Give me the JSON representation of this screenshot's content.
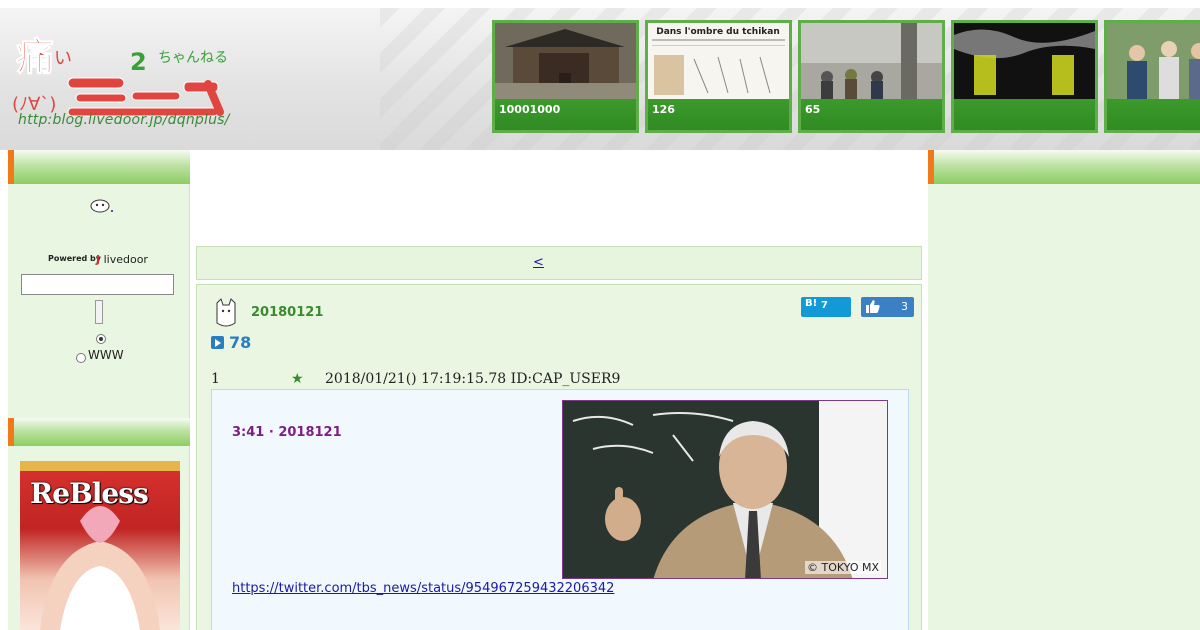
{
  "header": {
    "logo_url_text": "http:blog.livedoor.jp/dqnplus/",
    "thumbnails": [
      {
        "count": "10001000",
        "image": "temple-photo"
      },
      {
        "count": "126",
        "image": "document-photo",
        "doc_title": "Dans l'ombre du tchikan"
      },
      {
        "count": "65",
        "image": "street-photo"
      },
      {
        "count": "",
        "image": "poster-photo"
      },
      {
        "count": "",
        "image": "family-photo"
      }
    ]
  },
  "sidebar_left": {
    "powered_by": "Powered by",
    "livedoor_brand": "livedoor",
    "search": {
      "placeholder": "",
      "value": ""
    },
    "radio_options": [
      "",
      "WWW"
    ],
    "banner_text": "ReBless"
  },
  "main": {
    "nav_prev": "<",
    "article": {
      "date": "20180121",
      "hatena_count": "7",
      "like_count": "3",
      "comment_count": "78",
      "res": {
        "num": "1",
        "star": "★",
        "meta": "2018/01/21() 17:19:15.78 ID:CAP_USER9"
      },
      "quote": {
        "title": "3:41 · 2018121",
        "photo_credit": "© TOKYO MX",
        "link": "https://twitter.com/tbs_news/status/954967259432206342"
      }
    }
  },
  "colors": {
    "accent_green": "#5fae4a",
    "sidebar_bg": "#e9f6e2",
    "accent_orange": "#f07a1a",
    "link_blue": "#1a1aa6",
    "title_purple": "#7d1f86"
  }
}
